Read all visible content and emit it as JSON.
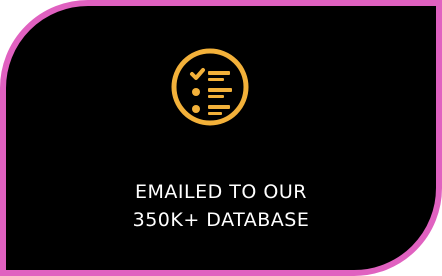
{
  "card": {
    "icon": "checklist-icon",
    "caption_line1": "EMAILED TO OUR",
    "caption_line2": "350K+ DATABASE"
  },
  "colors": {
    "background": "#000000",
    "border": "#e061c0",
    "icon": "#f3b13a",
    "text": "#ffffff"
  }
}
